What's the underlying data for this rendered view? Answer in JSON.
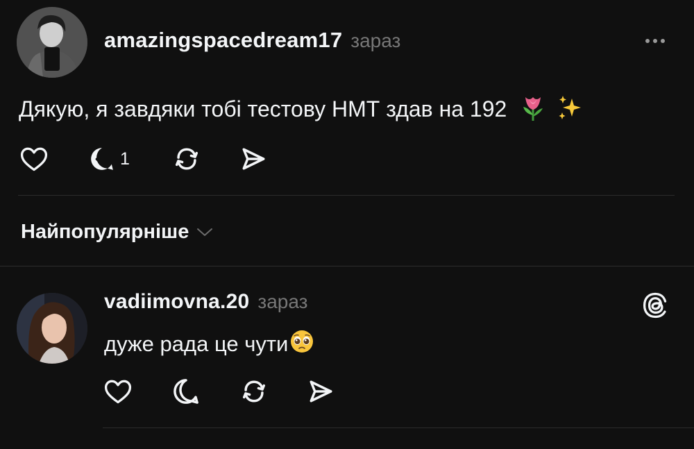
{
  "post": {
    "username": "amazingspacedream17",
    "time": "зараз",
    "text": "Дякую, я завдяки тобі тестову НМТ здав на 192",
    "emojis": [
      "tulip-emoji",
      "sparkles-emoji"
    ],
    "actions": {
      "like_icon": "heart-icon",
      "reply_icon": "reply-check-icon",
      "reply_count": "1",
      "repost_icon": "repost-icon",
      "share_icon": "send-icon"
    }
  },
  "sort": {
    "label": "Найпопулярніше"
  },
  "reply": {
    "username": "vadiimovna.20",
    "time": "зараз",
    "text": "дуже рада це чути",
    "emoji": "pleading-face-emoji",
    "actions": {
      "like_icon": "heart-icon",
      "reply_icon": "comment-icon",
      "repost_icon": "repost-icon",
      "share_icon": "send-icon"
    }
  },
  "colors": {
    "background": "#101010",
    "text": "#f3f5f7",
    "muted": "#777777",
    "divider": "#2c2c2c"
  }
}
